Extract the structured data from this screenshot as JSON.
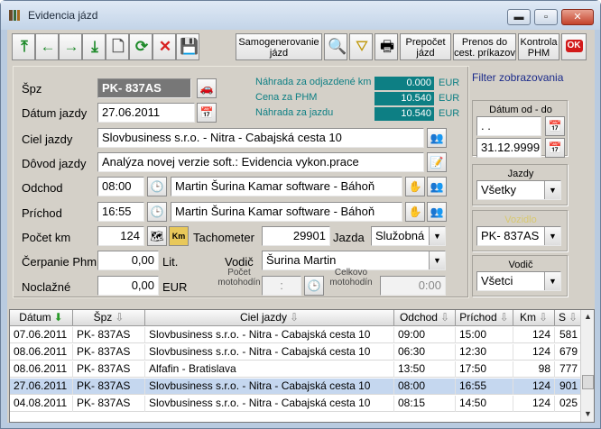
{
  "window": {
    "title": "Evidencia jázd",
    "minimize": "▬",
    "maximize": "▫",
    "close": "✕"
  },
  "toolbar": {
    "buttons": [
      {
        "name": "first-record-icon",
        "glyph": "⤒",
        "color": "#1e8a2a"
      },
      {
        "name": "prev-record-icon",
        "glyph": "←",
        "color": "#1e8a2a"
      },
      {
        "name": "next-record-icon",
        "glyph": "→",
        "color": "#1e8a2a"
      },
      {
        "name": "last-record-icon",
        "glyph": "⤓",
        "color": "#1e8a2a"
      },
      {
        "name": "new-document-icon",
        "glyph": "🗋",
        "color": "#555"
      },
      {
        "name": "refresh-icon",
        "glyph": "⟳",
        "color": "#1e8a2a"
      },
      {
        "name": "delete-icon",
        "glyph": "✕",
        "color": "#d82020"
      },
      {
        "name": "save-icon",
        "glyph": "💾",
        "color": "#2a4aa0"
      }
    ],
    "samogenerovanie": "Samogenerovanie jázd",
    "search_icon": "🔍",
    "filter_icon": "⛛",
    "print_icon": "🖶",
    "prepocet": "Prepočet jázd",
    "prenos": "Prenos do cest. príkazov",
    "kontrola": "Kontrola PHM",
    "ok": "OK"
  },
  "form": {
    "spz_label": "Špz",
    "spz": "PK- 837AS",
    "datum_label": "Dátum jazdy",
    "datum": "27.06.2011",
    "ciel_label": "Ciel jazdy",
    "ciel": "Slovbusiness s.r.o. - Nitra - Cabajská cesta 10",
    "dovod_label": "Dôvod jazdy",
    "dovod": "Analýza novej verzie soft.: Evidencia vykon.prace",
    "odchod_label": "Odchod",
    "odchod": "08:00",
    "odchod_place": "Martin Šurina Kamar software - Báhoň",
    "prichod_label": "Príchod",
    "prichod": "16:55",
    "prichod_place": "Martin Šurina Kamar software - Báhoň",
    "km_label": "Počet km",
    "km": "124",
    "km_btn": "Km",
    "tacho_label": "Tachometer",
    "tacho": "29901",
    "jazda_label": "Jazda",
    "jazda": "Služobná",
    "phm_label": "Čerpanie Phm",
    "phm": "0,00",
    "lit": "Lit.",
    "vodic_label": "Vodič",
    "vodic": "Šurina Martin",
    "noclazne_label": "Noclažné",
    "noclazne": "0,00",
    "eur": "EUR",
    "motohodiny_label": "Počet motohodín",
    "motohodiny": ":",
    "celk_label": "Celkovo motohodín",
    "celk": "0:00",
    "nahrada_od_label": "Náhrada za odjazdené km",
    "nahrada_od": "0.000",
    "nahrada_od_cur": "EUR",
    "cena_label": "Cena za PHM",
    "cena": "10.540",
    "cena_cur": "EUR",
    "nahrada_j_label": "Náhrada za jazdu",
    "nahrada_j": "10.540",
    "nahrada_j_cur": "EUR"
  },
  "filter": {
    "title": "Filter zobrazovania",
    "datum_label": "Dátum od - do",
    "from": " .  .",
    "to": "31.12.9999",
    "jazdy_label": "Jazdy",
    "jazdy": "Všetky",
    "vozidlo_label": "Vozidlo",
    "vozidlo": "PK- 837AS",
    "vodic_label": "Vodič",
    "vodic": "Všetci"
  },
  "grid": {
    "columns": [
      "Dátum",
      "Špz",
      "Ciel jazdy",
      "Odchod",
      "Príchod",
      "Km",
      "S"
    ],
    "rows": [
      [
        "07.06.2011",
        "PK- 837AS",
        "Slovbusiness s.r.o. - Nitra - Cabajská cesta 10",
        "09:00",
        "15:00",
        "124",
        "581"
      ],
      [
        "08.06.2011",
        "PK- 837AS",
        "Slovbusiness s.r.o. - Nitra - Cabajská cesta 10",
        "06:30",
        "12:30",
        "124",
        "679"
      ],
      [
        "08.06.2011",
        "PK- 837AS",
        "Alfafin - Bratislava",
        "13:50",
        "17:50",
        "98",
        "777"
      ],
      [
        "27.06.2011",
        "PK- 837AS",
        "Slovbusiness s.r.o. - Nitra - Cabajská cesta 10",
        "08:00",
        "16:55",
        "124",
        "901"
      ],
      [
        "04.08.2011",
        "PK- 837AS",
        "Slovbusiness s.r.o. - Nitra - Cabajská cesta 10",
        "08:15",
        "14:50",
        "124",
        "025"
      ]
    ],
    "selected_row": 3
  }
}
